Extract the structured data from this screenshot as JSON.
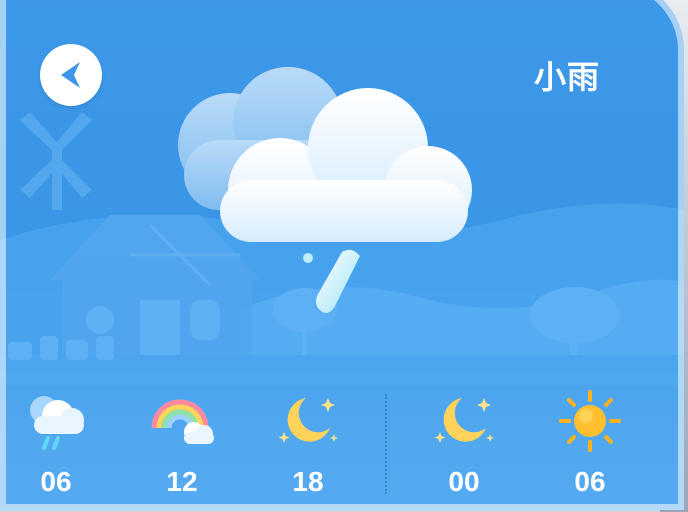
{
  "header": {
    "back_icon": "back-arrow-icon",
    "condition": "小雨"
  },
  "hero": {
    "icon": "light-rain-cloud-icon"
  },
  "forecast": {
    "slots": [
      {
        "time": "06",
        "icon": "rain-cloud-icon"
      },
      {
        "time": "12",
        "icon": "rainbow-icon"
      },
      {
        "time": "18",
        "icon": "moon-stars-icon"
      },
      {
        "time": "00",
        "icon": "moon-stars-icon"
      },
      {
        "time": "06",
        "icon": "sun-icon"
      }
    ]
  },
  "colors": {
    "card_bg": "#3d98e8",
    "text": "#ffffff",
    "sun": "#ffb21e",
    "moon": "#ffd25c"
  }
}
